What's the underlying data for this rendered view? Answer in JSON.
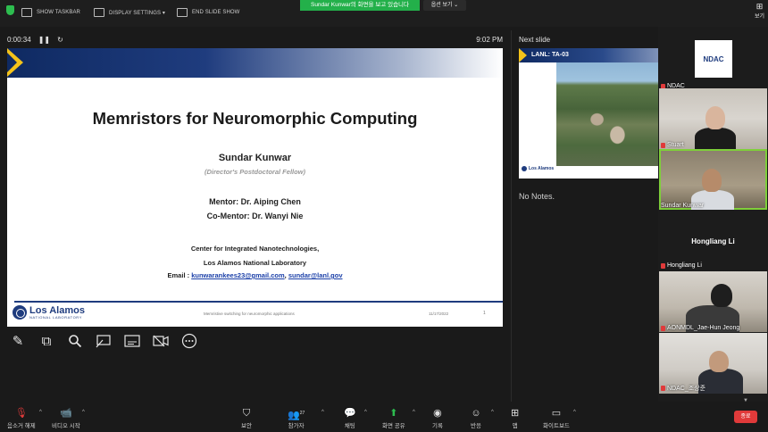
{
  "topbar": {
    "show_taskbar": "SHOW TASKBAR",
    "display_settings": "DISPLAY SETTINGS ▾",
    "end_slide_show": "END SLIDE SHOW",
    "share_banner": "Sundar Kunwar의 화면을 보고 있습니다",
    "view_options": "옵션 보기 ⌄",
    "view_button": "보기"
  },
  "presenter": {
    "elapsed": "0:00:34",
    "pause_icon": "pause-icon",
    "restart_icon": "restart-icon",
    "clock": "9:02 PM",
    "next_slide_label": "Next slide",
    "notes": "No Notes."
  },
  "slide": {
    "title": "Memristors for Neuromorphic Computing",
    "name": "Sundar Kunwar",
    "role": "(Director's Postdoctoral Fellow)",
    "mentor": "Mentor: Dr. Aiping Chen",
    "comentor": "Co-Mentor: Dr. Wanyi Nie",
    "center": "Center for Integrated Nanotechnologies,",
    "lab": "Los Alamos National Laboratory",
    "email_label": "Email : ",
    "email_1": "kunwarankees23@gmail.com",
    "email_sep": ", ",
    "email_2": "sundar@lanl.gov",
    "logo_main": "Los Alamos",
    "logo_sub": "NATIONAL LABORATORY",
    "footer_mid": "Memristive switching for neuromorphic applications",
    "footer_date": "11/17/2022",
    "footer_page": "1",
    "accent_color": "#1f3c7e",
    "chevron_color": "#f4c31a"
  },
  "next_slide": {
    "title": "LANL: TA-03",
    "logo": "Los Alamos"
  },
  "participants": [
    {
      "name": "NDAC",
      "logo": "NDAC"
    },
    {
      "name": "Stuart"
    },
    {
      "name": "Sundar Kunwar"
    },
    {
      "name": "Hongliang Li",
      "center_label": "Hongliang Li"
    },
    {
      "name": "AONMDL_Jae-Hun Jeong"
    },
    {
      "name": "NDAC_조상준"
    }
  ],
  "tools": [
    "pen-icon",
    "layers-icon",
    "magnifier-icon",
    "laser-pointer-icon",
    "subtitles-icon",
    "camera-off-icon",
    "more-icon"
  ],
  "bottombar": {
    "mute": "음소거 해제",
    "video": "비디오 시작",
    "security": "보안",
    "participants": "참가자",
    "participants_count": "27",
    "chat": "채팅",
    "share": "화면 공유",
    "record": "기록",
    "reactions": "반응",
    "apps": "앱",
    "whiteboard": "화이트보드",
    "end": "종료"
  }
}
